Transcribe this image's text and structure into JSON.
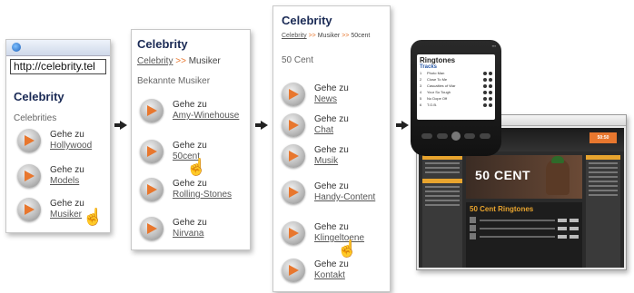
{
  "panel1": {
    "url": "http://celebrity.tel",
    "title": "Celebrity",
    "subtitle": "Celebrities",
    "items": [
      {
        "prefix": "Gehe zu",
        "link": "Hollywood"
      },
      {
        "prefix": "Gehe zu",
        "link": "Models"
      },
      {
        "prefix": "Gehe zu",
        "link": "Musiker"
      }
    ]
  },
  "panel2": {
    "title": "Celebrity",
    "breadcrumb": {
      "root": "Celebrity",
      "sep": ">>",
      "current": "Musiker"
    },
    "subtitle": "Bekannte Musiker",
    "items": [
      {
        "prefix": "Gehe zu",
        "link": "Amy-Winehouse"
      },
      {
        "prefix": "Gehe zu",
        "link": "50cent"
      },
      {
        "prefix": "Gehe zu",
        "link": "Rolling-Stones"
      },
      {
        "prefix": "Gehe zu",
        "link": "Nirvana"
      }
    ]
  },
  "panel3": {
    "title": "Celebrity",
    "breadcrumb": {
      "root": "Celebrity",
      "sep": ">>",
      "mid": "Musiker",
      "sep2": ">>",
      "current": "50cent"
    },
    "subtitle": "50 Cent",
    "items": [
      {
        "prefix": "Gehe zu",
        "link": "News"
      },
      {
        "prefix": "Gehe zu",
        "link": "Chat"
      },
      {
        "prefix": "Gehe zu",
        "link": "Musik"
      },
      {
        "prefix": "Gehe zu",
        "link": "Handy-Content"
      },
      {
        "prefix": "Gehe zu",
        "link": "Klingeltoene"
      },
      {
        "prefix": "Gehe zu",
        "link": "Kontakt"
      }
    ]
  },
  "phone": {
    "title": "Ringtones",
    "subtitle": "Tracks",
    "tracks": [
      {
        "n": "1",
        "name": "Photo Man"
      },
      {
        "n": "2",
        "name": "Close To Me"
      },
      {
        "n": "3",
        "name": "Casualties of War"
      },
      {
        "n": "4",
        "name": "Your So Tough"
      },
      {
        "n": "5",
        "name": "No Dope Off"
      },
      {
        "n": "6",
        "name": "T.O.B."
      }
    ]
  },
  "browser": {
    "logo": "50:50",
    "hero": "50 CENT",
    "list_title": "50 Cent Ringtones"
  },
  "colors": {
    "accent": "#e8772e",
    "title": "#1a2a55"
  }
}
